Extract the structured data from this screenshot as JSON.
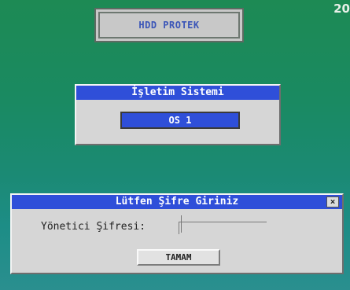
{
  "screen": {
    "corner_text": "20"
  },
  "protek": {
    "label": "HDD PROTEK"
  },
  "os_dialog": {
    "title": "İşletim Sistemi",
    "selected": "OS 1"
  },
  "password_dialog": {
    "title": "Lütfen Şifre Giriniz",
    "close_label": "×",
    "field_label": "Yönetici Şifresi:",
    "field_value": "",
    "ok_label": "TAMAM"
  }
}
